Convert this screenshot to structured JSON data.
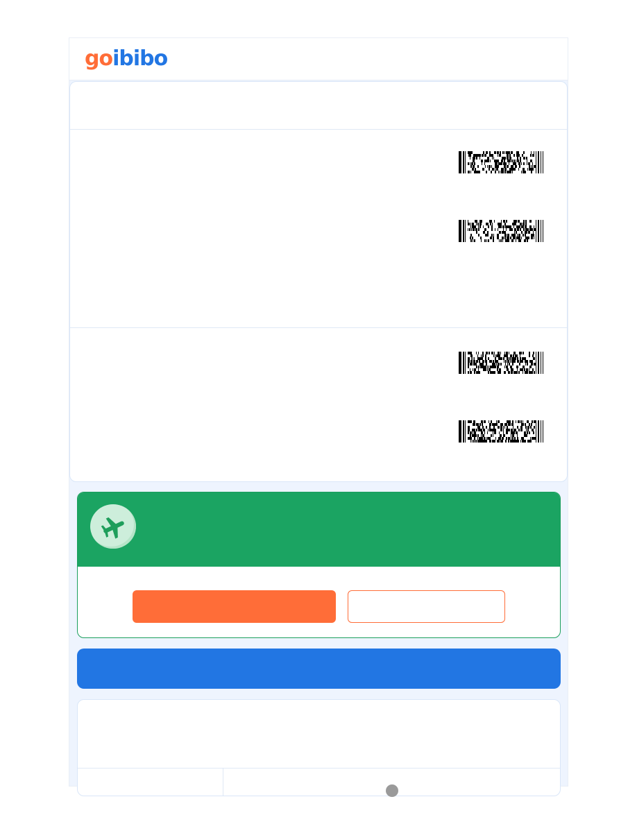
{
  "brand": {
    "logo_part1": "go",
    "logo_part2": "ibibo",
    "color_go": "#ff6d38",
    "color_ibibo": "#2276e3"
  },
  "ticket": {
    "segments": [
      {
        "barcodes": [
          {
            "icon": "barcode-icon"
          },
          {
            "icon": "barcode-icon"
          }
        ]
      },
      {
        "barcodes": [
          {
            "icon": "barcode-icon"
          },
          {
            "icon": "barcode-icon"
          }
        ]
      }
    ]
  },
  "promo": {
    "icon": "airplane-icon",
    "accent": "#1ba462",
    "primary_button_color": "#ff6d38"
  },
  "banner": {
    "color": "#2276e3"
  }
}
